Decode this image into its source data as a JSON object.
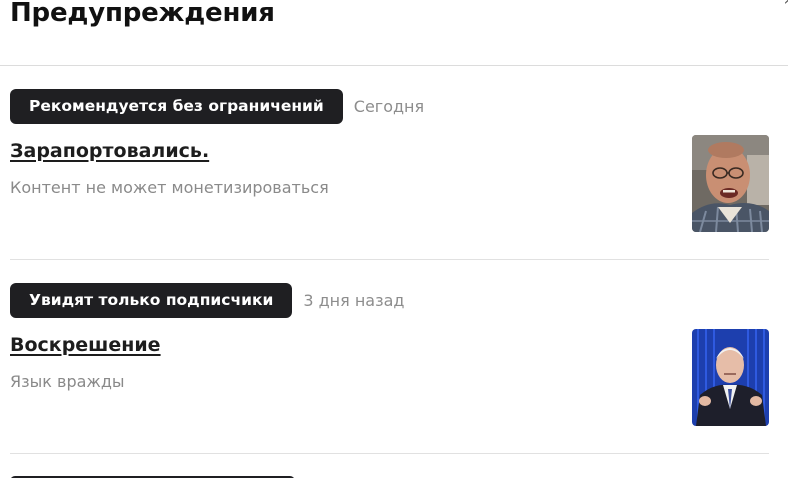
{
  "header": {
    "title": "Предупреждения",
    "close_icon": "close-icon"
  },
  "warnings": [
    {
      "badge": "Рекомендуется без ограничений",
      "date": "Сегодня",
      "title": "Зарапортовались.",
      "reason": "Контент не может монетизироваться",
      "thumbnail": "portrait-older-man-photo"
    },
    {
      "badge": "Увидят только подписчики",
      "date": "3 дня назад",
      "title": "Воскрешение",
      "reason": "Язык вражды",
      "thumbnail": "portrait-man-suit-blue-backdrop-photo"
    }
  ],
  "colors": {
    "badge_bg": "#1f1f22",
    "badge_text": "#ffffff",
    "muted_text": "#8a8a8a",
    "title_text": "#1d1d1d",
    "divider": "#e1e1e1"
  }
}
